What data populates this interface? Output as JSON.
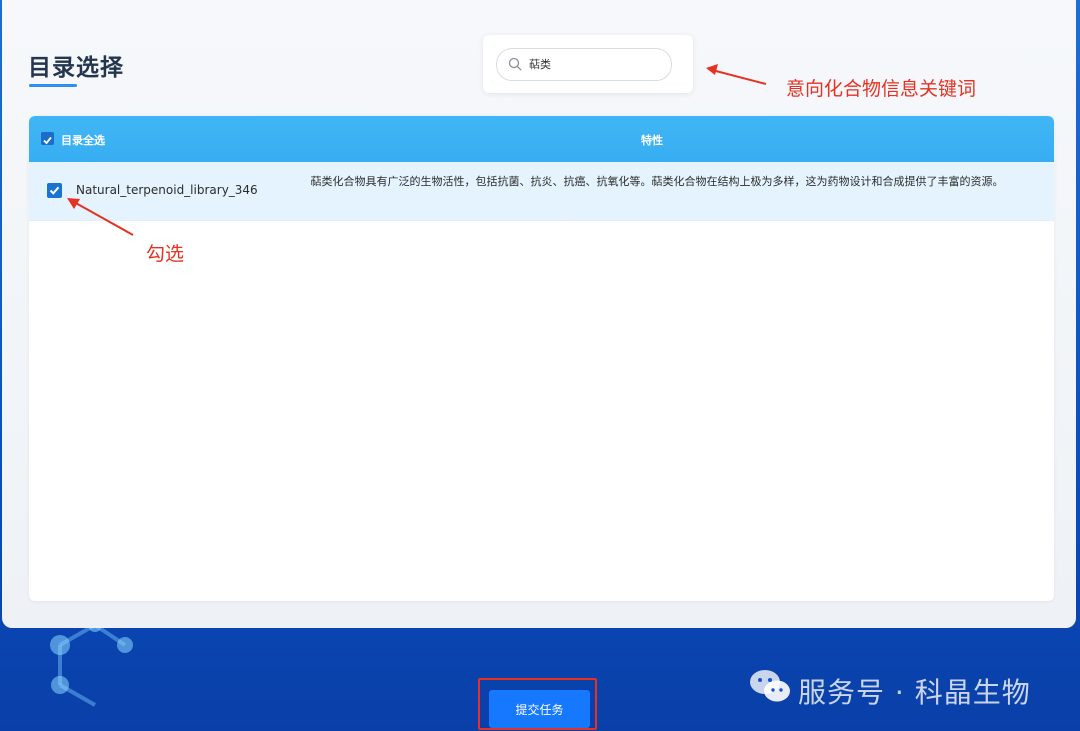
{
  "page": {
    "title": "目录选择"
  },
  "search": {
    "value": "萜类"
  },
  "table": {
    "header": {
      "select_all_label": "目录全选",
      "feature_label": "特性"
    },
    "rows": [
      {
        "name": "Natural_terpenoid_library_346",
        "checked": true,
        "description": "萜类化合物具有广泛的生物活性，包括抗菌、抗炎、抗癌、抗氧化等。萜类化合物在结构上极为多样，这为药物设计和合成提供了丰富的资源。"
      }
    ]
  },
  "annotations": {
    "keyword_note": "意向化合物信息关键词",
    "check_note": "勾选"
  },
  "actions": {
    "submit_label": "提交任务"
  },
  "watermark": {
    "text": "服务号 · 科晶生物"
  },
  "colors": {
    "header_blue": "#37aef2",
    "submit_blue": "#1677ff",
    "annotation_red": "#e53223",
    "row_highlight": "#e4f3fd"
  }
}
